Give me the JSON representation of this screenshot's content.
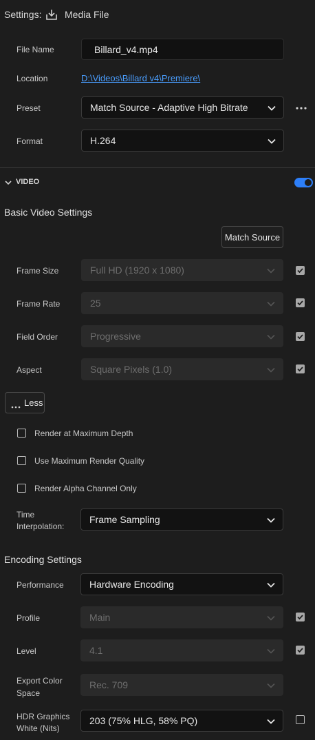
{
  "header": {
    "settings_label": "Settings:",
    "media_file_label": "Media File"
  },
  "file_name": {
    "label": "File Name",
    "value": "Billard_v4.mp4"
  },
  "location": {
    "label": "Location",
    "value": "D:\\Videos\\Billard v4\\Premiere\\"
  },
  "preset": {
    "label": "Preset",
    "value": "Match Source - Adaptive High Bitrate"
  },
  "format": {
    "label": "Format",
    "value": "H.264"
  },
  "video_section": {
    "title": "VIDEO",
    "toggle_on": true
  },
  "basic_video": {
    "title": "Basic Video Settings",
    "match_source_label": "Match Source",
    "rows": [
      {
        "label": "Frame Size",
        "value": "Full HD (1920 x 1080)",
        "checked": true
      },
      {
        "label": "Frame Rate",
        "value": "25",
        "checked": true
      },
      {
        "label": "Field Order",
        "value": "Progressive",
        "checked": true
      },
      {
        "label": "Aspect",
        "value": "Square Pixels (1.0)",
        "checked": true
      }
    ],
    "less_label": "Less",
    "options": [
      {
        "label": "Render at Maximum Depth",
        "checked": false
      },
      {
        "label": "Use Maximum Render Quality",
        "checked": false
      },
      {
        "label": "Render Alpha Channel Only",
        "checked": false
      }
    ],
    "time_interp": {
      "label_line1": "Time",
      "label_line2": "Interpolation:",
      "value": "Frame Sampling"
    }
  },
  "encoding": {
    "title": "Encoding Settings",
    "performance": {
      "label": "Performance",
      "value": "Hardware Encoding"
    },
    "profile": {
      "label": "Profile",
      "value": "Main",
      "checked": true
    },
    "level": {
      "label": "Level",
      "value": "4.1",
      "checked": true
    },
    "color_space": {
      "label_line1": "Export Color",
      "label_line2": "Space",
      "value": "Rec. 709"
    },
    "hdr": {
      "label_line1": "HDR Graphics",
      "label_line2": "White (Nits)",
      "value": "203 (75% HLG, 58% PQ)",
      "checked": false
    }
  },
  "colors": {
    "accent": "#2d7ff9",
    "link": "#4a9eff"
  }
}
